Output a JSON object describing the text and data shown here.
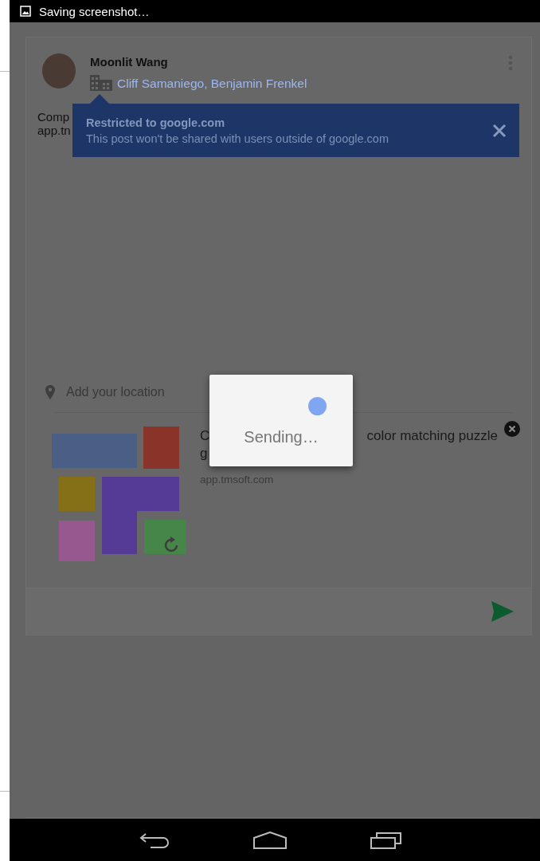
{
  "status_bar": {
    "text": "Saving screenshot…"
  },
  "post": {
    "author": "Moonlit Wang",
    "audience": "Cliff Samaniego, Benjamin Frenkel",
    "text_lines": [
      "Comp",
      "app.tn"
    ]
  },
  "restriction_tooltip": {
    "title": "Restricted to google.com",
    "message": "This post won't be shared with users outside of google.com"
  },
  "location": {
    "placeholder": "Add your location"
  },
  "link_preview": {
    "title_lines": [
      [
        "C",
        "color matching puzzle"
      ],
      [
        "g"
      ]
    ],
    "url": "app.tmsoft.com"
  },
  "dialog": {
    "message": "Sending…"
  }
}
